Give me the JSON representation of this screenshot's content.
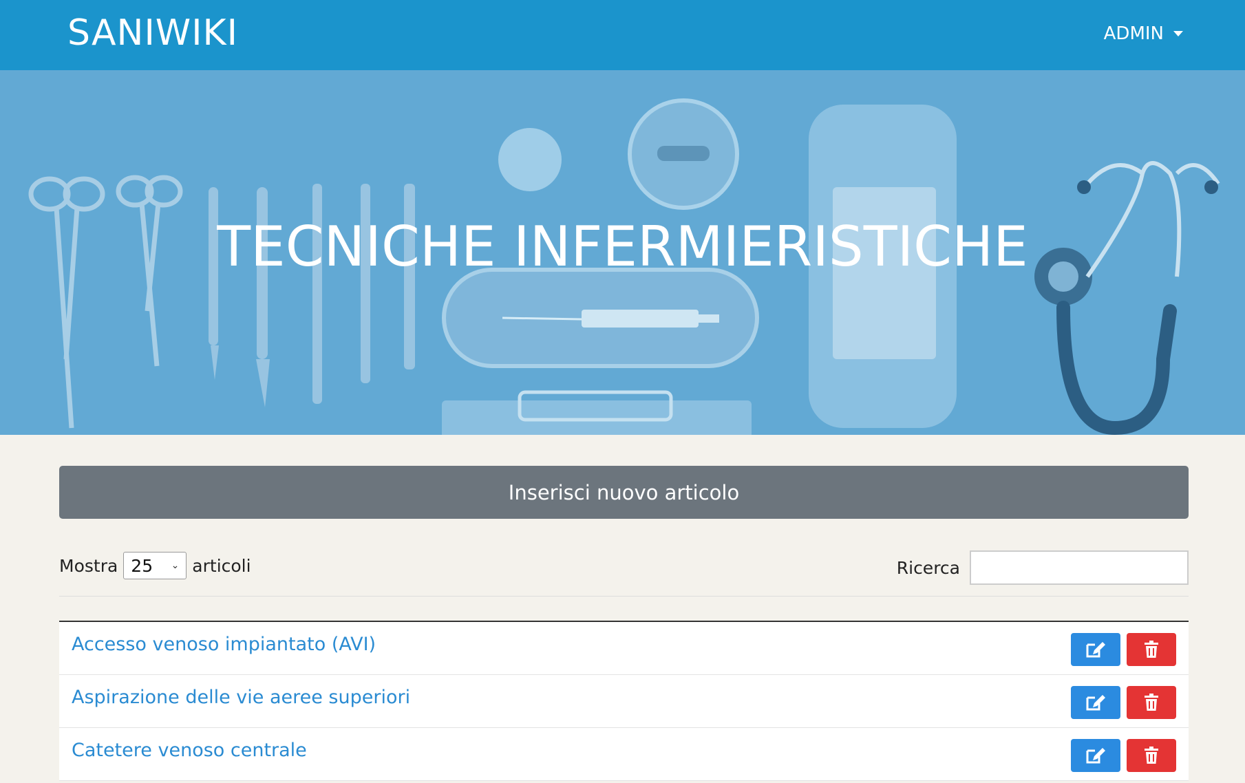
{
  "navbar": {
    "brand": "SANIWIKI",
    "user_menu": "ADMIN"
  },
  "hero": {
    "title": "TECNICHE INFERMIERISTICHE"
  },
  "new_article_button": "Inserisci nuovo articolo",
  "controls": {
    "show_label": "Mostra",
    "page_size": "25",
    "items_label": "articoli",
    "search_label": "Ricerca",
    "search_value": ""
  },
  "articles": [
    {
      "title": "Accesso venoso impiantato (AVI)"
    },
    {
      "title": "Aspirazione delle vie aeree superiori"
    },
    {
      "title": "Catetere venoso centrale"
    }
  ],
  "colors": {
    "navbar": "#1b94cc",
    "hero_tint": "#62a9d4",
    "edit_button": "#2b8be0",
    "delete_button": "#e43434",
    "link": "#2a8bd2"
  },
  "icons": {
    "edit": "edit-icon",
    "delete": "trash-icon",
    "dropdown": "caret-down-icon"
  }
}
